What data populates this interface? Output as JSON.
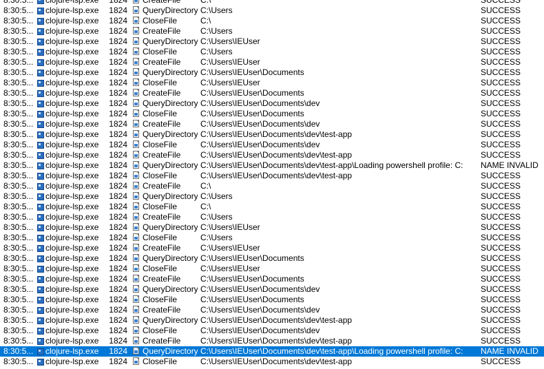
{
  "colors": {
    "row_bg": "#ffffff",
    "selection_bg": "#0078d7",
    "selection_text": "#ffffff",
    "process_icon": "#2a6fc0"
  },
  "icons": {
    "process": "application-window-icon",
    "operation": "file-system-icon"
  },
  "selected_index": 34,
  "rows": [
    {
      "time": "8:30:5...",
      "process": "clojure-lsp.exe",
      "pid": "1824",
      "operation": "CreateFile",
      "path": "C:\\",
      "result": "SUCCESS"
    },
    {
      "time": "8:30:5...",
      "process": "clojure-lsp.exe",
      "pid": "1824",
      "operation": "QueryDirectory",
      "path": "C:\\Users",
      "result": "SUCCESS"
    },
    {
      "time": "8:30:5...",
      "process": "clojure-lsp.exe",
      "pid": "1824",
      "operation": "CloseFile",
      "path": "C:\\",
      "result": "SUCCESS"
    },
    {
      "time": "8:30:5...",
      "process": "clojure-lsp.exe",
      "pid": "1824",
      "operation": "CreateFile",
      "path": "C:\\Users",
      "result": "SUCCESS"
    },
    {
      "time": "8:30:5...",
      "process": "clojure-lsp.exe",
      "pid": "1824",
      "operation": "QueryDirectory",
      "path": "C:\\Users\\IEUser",
      "result": "SUCCESS"
    },
    {
      "time": "8:30:5...",
      "process": "clojure-lsp.exe",
      "pid": "1824",
      "operation": "CloseFile",
      "path": "C:\\Users",
      "result": "SUCCESS"
    },
    {
      "time": "8:30:5...",
      "process": "clojure-lsp.exe",
      "pid": "1824",
      "operation": "CreateFile",
      "path": "C:\\Users\\IEUser",
      "result": "SUCCESS"
    },
    {
      "time": "8:30:5...",
      "process": "clojure-lsp.exe",
      "pid": "1824",
      "operation": "QueryDirectory",
      "path": "C:\\Users\\IEUser\\Documents",
      "result": "SUCCESS"
    },
    {
      "time": "8:30:5...",
      "process": "clojure-lsp.exe",
      "pid": "1824",
      "operation": "CloseFile",
      "path": "C:\\Users\\IEUser",
      "result": "SUCCESS"
    },
    {
      "time": "8:30:5...",
      "process": "clojure-lsp.exe",
      "pid": "1824",
      "operation": "CreateFile",
      "path": "C:\\Users\\IEUser\\Documents",
      "result": "SUCCESS"
    },
    {
      "time": "8:30:5...",
      "process": "clojure-lsp.exe",
      "pid": "1824",
      "operation": "QueryDirectory",
      "path": "C:\\Users\\IEUser\\Documents\\dev",
      "result": "SUCCESS"
    },
    {
      "time": "8:30:5...",
      "process": "clojure-lsp.exe",
      "pid": "1824",
      "operation": "CloseFile",
      "path": "C:\\Users\\IEUser\\Documents",
      "result": "SUCCESS"
    },
    {
      "time": "8:30:5...",
      "process": "clojure-lsp.exe",
      "pid": "1824",
      "operation": "CreateFile",
      "path": "C:\\Users\\IEUser\\Documents\\dev",
      "result": "SUCCESS"
    },
    {
      "time": "8:30:5...",
      "process": "clojure-lsp.exe",
      "pid": "1824",
      "operation": "QueryDirectory",
      "path": "C:\\Users\\IEUser\\Documents\\dev\\test-app",
      "result": "SUCCESS"
    },
    {
      "time": "8:30:5...",
      "process": "clojure-lsp.exe",
      "pid": "1824",
      "operation": "CloseFile",
      "path": "C:\\Users\\IEUser\\Documents\\dev",
      "result": "SUCCESS"
    },
    {
      "time": "8:30:5...",
      "process": "clojure-lsp.exe",
      "pid": "1824",
      "operation": "CreateFile",
      "path": "C:\\Users\\IEUser\\Documents\\dev\\test-app",
      "result": "SUCCESS"
    },
    {
      "time": "8:30:5...",
      "process": "clojure-lsp.exe",
      "pid": "1824",
      "operation": "QueryDirectory",
      "path": "C:\\Users\\IEUser\\Documents\\dev\\test-app\\Loading powershell profile: C:",
      "result": "NAME INVALID"
    },
    {
      "time": "8:30:5...",
      "process": "clojure-lsp.exe",
      "pid": "1824",
      "operation": "CloseFile",
      "path": "C:\\Users\\IEUser\\Documents\\dev\\test-app",
      "result": "SUCCESS"
    },
    {
      "time": "8:30:5...",
      "process": "clojure-lsp.exe",
      "pid": "1824",
      "operation": "CreateFile",
      "path": "C:\\",
      "result": "SUCCESS"
    },
    {
      "time": "8:30:5...",
      "process": "clojure-lsp.exe",
      "pid": "1824",
      "operation": "QueryDirectory",
      "path": "C:\\Users",
      "result": "SUCCESS"
    },
    {
      "time": "8:30:5...",
      "process": "clojure-lsp.exe",
      "pid": "1824",
      "operation": "CloseFile",
      "path": "C:\\",
      "result": "SUCCESS"
    },
    {
      "time": "8:30:5...",
      "process": "clojure-lsp.exe",
      "pid": "1824",
      "operation": "CreateFile",
      "path": "C:\\Users",
      "result": "SUCCESS"
    },
    {
      "time": "8:30:5...",
      "process": "clojure-lsp.exe",
      "pid": "1824",
      "operation": "QueryDirectory",
      "path": "C:\\Users\\IEUser",
      "result": "SUCCESS"
    },
    {
      "time": "8:30:5...",
      "process": "clojure-lsp.exe",
      "pid": "1824",
      "operation": "CloseFile",
      "path": "C:\\Users",
      "result": "SUCCESS"
    },
    {
      "time": "8:30:5...",
      "process": "clojure-lsp.exe",
      "pid": "1824",
      "operation": "CreateFile",
      "path": "C:\\Users\\IEUser",
      "result": "SUCCESS"
    },
    {
      "time": "8:30:5...",
      "process": "clojure-lsp.exe",
      "pid": "1824",
      "operation": "QueryDirectory",
      "path": "C:\\Users\\IEUser\\Documents",
      "result": "SUCCESS"
    },
    {
      "time": "8:30:5...",
      "process": "clojure-lsp.exe",
      "pid": "1824",
      "operation": "CloseFile",
      "path": "C:\\Users\\IEUser",
      "result": "SUCCESS"
    },
    {
      "time": "8:30:5...",
      "process": "clojure-lsp.exe",
      "pid": "1824",
      "operation": "CreateFile",
      "path": "C:\\Users\\IEUser\\Documents",
      "result": "SUCCESS"
    },
    {
      "time": "8:30:5...",
      "process": "clojure-lsp.exe",
      "pid": "1824",
      "operation": "QueryDirectory",
      "path": "C:\\Users\\IEUser\\Documents\\dev",
      "result": "SUCCESS"
    },
    {
      "time": "8:30:5...",
      "process": "clojure-lsp.exe",
      "pid": "1824",
      "operation": "CloseFile",
      "path": "C:\\Users\\IEUser\\Documents",
      "result": "SUCCESS"
    },
    {
      "time": "8:30:5...",
      "process": "clojure-lsp.exe",
      "pid": "1824",
      "operation": "CreateFile",
      "path": "C:\\Users\\IEUser\\Documents\\dev",
      "result": "SUCCESS"
    },
    {
      "time": "8:30:5...",
      "process": "clojure-lsp.exe",
      "pid": "1824",
      "operation": "QueryDirectory",
      "path": "C:\\Users\\IEUser\\Documents\\dev\\test-app",
      "result": "SUCCESS"
    },
    {
      "time": "8:30:5...",
      "process": "clojure-lsp.exe",
      "pid": "1824",
      "operation": "CloseFile",
      "path": "C:\\Users\\IEUser\\Documents\\dev",
      "result": "SUCCESS"
    },
    {
      "time": "8:30:5...",
      "process": "clojure-lsp.exe",
      "pid": "1824",
      "operation": "CreateFile",
      "path": "C:\\Users\\IEUser\\Documents\\dev\\test-app",
      "result": "SUCCESS"
    },
    {
      "time": "8:30:5...",
      "process": "clojure-lsp.exe",
      "pid": "1824",
      "operation": "QueryDirectory",
      "path": "C:\\Users\\IEUser\\Documents\\dev\\test-app\\Loading powershell profile: C:",
      "result": "NAME INVALID"
    },
    {
      "time": "8:30:5...",
      "process": "clojure-lsp.exe",
      "pid": "1824",
      "operation": "CloseFile",
      "path": "C:\\Users\\IEUser\\Documents\\dev\\test-app",
      "result": "SUCCESS"
    }
  ]
}
